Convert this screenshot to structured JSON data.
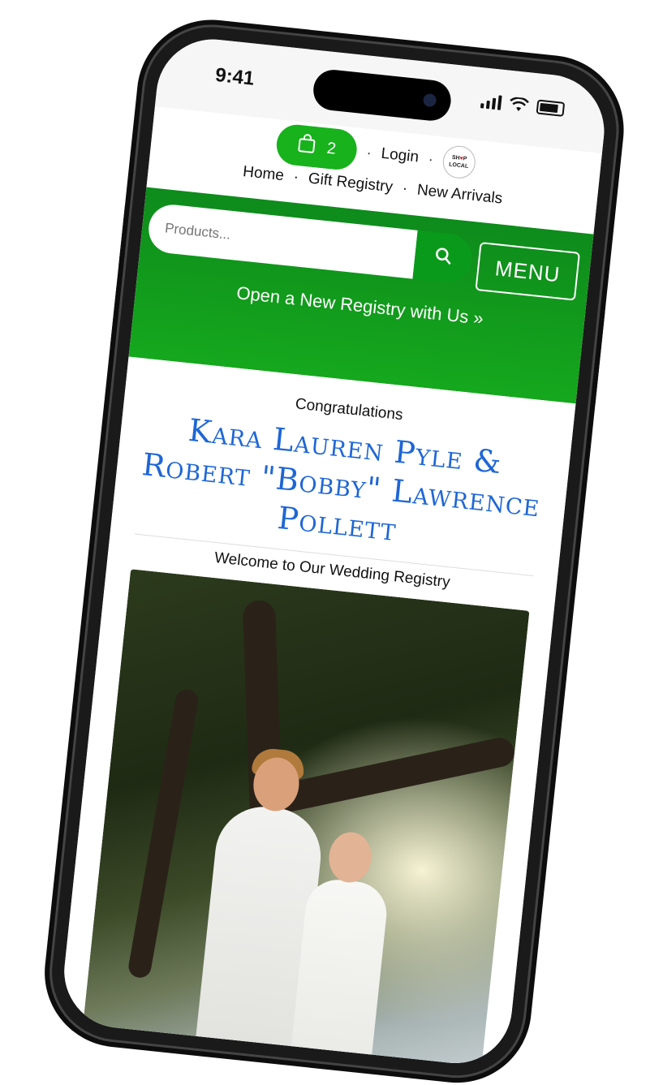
{
  "status_bar": {
    "time": "9:41"
  },
  "header": {
    "cart_count": "2",
    "login_label": "Login",
    "shop_local_line1": "SH",
    "shop_local_line2": "P",
    "shop_local_line3": "LOCAL",
    "separator": "·",
    "nav": [
      "Home",
      "Gift Registry",
      "New Arrivals"
    ]
  },
  "search": {
    "placeholder": "Products..."
  },
  "menu_label": "MENU",
  "promo_link": "Open a New Registry with Us »",
  "registry": {
    "congrats": "Congratulations",
    "names": "Kara Lauren Pyle & Robert \"Bobby\" Lawrence Pollett",
    "welcome": "Welcome to Our Wedding Registry"
  },
  "colors": {
    "brand_green": "#17b21c",
    "name_blue": "#1e66d6"
  }
}
